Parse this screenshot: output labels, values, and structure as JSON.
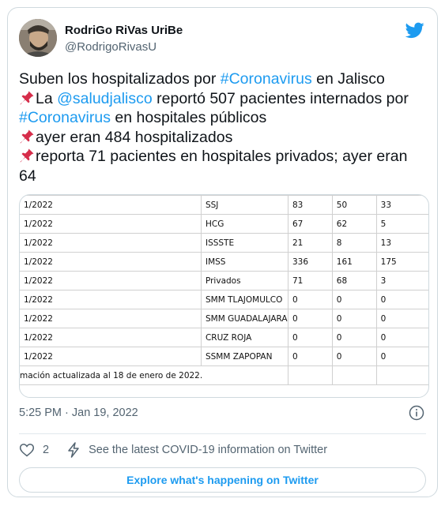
{
  "author": {
    "name": "RodriGo RiVas UriBe",
    "handle": "@RodrigoRivasU"
  },
  "tweet": {
    "line1": {
      "pre": "Suben los hospitalizados por ",
      "hashtag": "#Coronavirus",
      "post": " en Jalisco"
    },
    "line2": {
      "pre": "La ",
      "mention": "@saludjalisco",
      "post": " reportó 507 pacientes internados por"
    },
    "line3": {
      "hashtag": "#Coronavirus",
      "post": " en hospitales públicos"
    },
    "line4": {
      "text": "ayer eran 484 hospitalizados"
    },
    "line5": {
      "text": "reporta 71 pacientes en hospitales privados; ayer eran"
    },
    "line6": {
      "text": "64"
    }
  },
  "media_table": {
    "rows": [
      [
        "1/2022",
        "SSJ",
        "83",
        "50",
        "33"
      ],
      [
        "1/2022",
        "HCG",
        "67",
        "62",
        "5"
      ],
      [
        "1/2022",
        "ISSSTE",
        "21",
        "8",
        "13"
      ],
      [
        "1/2022",
        "IMSS",
        "336",
        "161",
        "175"
      ],
      [
        "1/2022",
        "Privados",
        "71",
        "68",
        "3"
      ],
      [
        "1/2022",
        "SMM TLAJOMULCO",
        "0",
        "0",
        "0"
      ],
      [
        "1/2022",
        "SMM GUADALAJARA",
        "0",
        "0",
        "0"
      ],
      [
        "1/2022",
        "CRUZ ROJA",
        "0",
        "0",
        "0"
      ],
      [
        "1/2022",
        "SSMM ZAPOPAN",
        "0",
        "0",
        "0"
      ]
    ],
    "footer": "mación actualizada al 18 de enero de 2022."
  },
  "timestamp": "5:25 PM · Jan 19, 2022",
  "actions": {
    "like_count": "2",
    "covid_info": "See the latest COVID-19 information on Twitter"
  },
  "explore_label": "Explore what's happening on Twitter",
  "icons": {
    "logo": "twitter-bird-icon",
    "pin": "pushpin-icon",
    "info": "info-icon",
    "like": "heart-icon",
    "covid": "lightning-bolt-icon"
  },
  "colors": {
    "link": "#1d9bf0",
    "secondary_text": "#536471",
    "border": "#cfd9de",
    "pin": "#d62d4a"
  }
}
